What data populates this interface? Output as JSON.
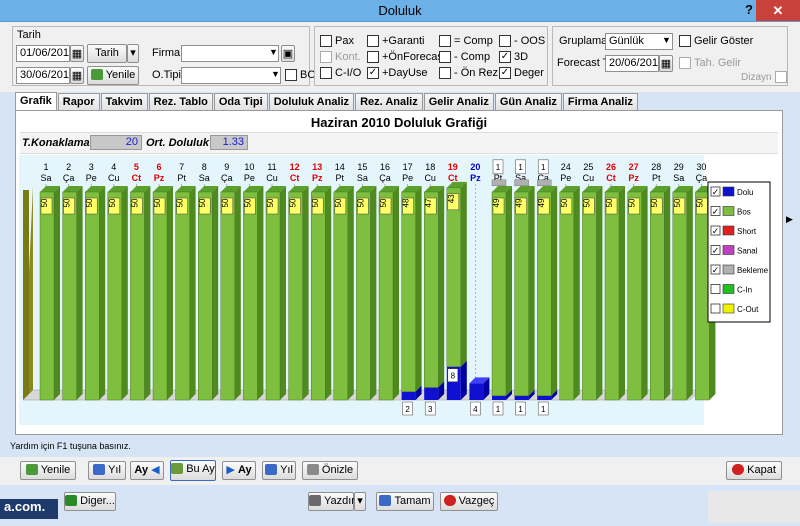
{
  "window": {
    "title": "Doluluk",
    "help": "?",
    "close": "✕"
  },
  "filters": {
    "tarih_label": "Tarih",
    "date_from": "01/06/2010",
    "date_to": "30/06/2010",
    "tarih_button": "Tarih",
    "yenile_button": "Yenile",
    "firma_label": "Firma",
    "firma_value": "",
    "otipi_label": "O.Tipi",
    "otipi_value": "",
    "bo_label": "BO"
  },
  "options": [
    {
      "label": "Pax",
      "checked": false,
      "disabled": false
    },
    {
      "label": "Kont.",
      "checked": false,
      "disabled": true
    },
    {
      "label": "C-I/O",
      "checked": false,
      "disabled": false
    },
    {
      "label": "+Garanti",
      "checked": false,
      "disabled": false
    },
    {
      "label": "+ÖnForecast",
      "checked": false,
      "disabled": false
    },
    {
      "label": "+DayUse",
      "checked": true,
      "disabled": false
    },
    {
      "label": "= Comp",
      "checked": false,
      "disabled": false
    },
    {
      "label": "- Comp",
      "checked": false,
      "disabled": false
    },
    {
      "label": "- Ön Rez.",
      "checked": false,
      "disabled": false
    },
    {
      "label": "- OOS",
      "checked": false,
      "disabled": false
    },
    {
      "label": "3D",
      "checked": true,
      "disabled": false
    },
    {
      "label": "Deger",
      "checked": true,
      "disabled": false
    }
  ],
  "grouping": {
    "gruplama_label": "Gruplama",
    "gruplama_value": "Günlük",
    "forecast_label": "Forecast T.",
    "forecast_value": "20/06/2010",
    "gelir_goster": "Gelir Göster",
    "tah_gelir": "Tah. Gelir",
    "dizayn": "Dizayn"
  },
  "tabs": [
    "Grafik",
    "Rapor",
    "Takvim",
    "Rez. Tablo",
    "Oda Tipi",
    "Doluluk Analiz",
    "Rez. Analiz",
    "Gelir Analiz",
    "Gün Analiz",
    "Firma Analiz"
  ],
  "summary": {
    "tkonaklama_label": "T.Konaklama :",
    "tkonaklama_value": "20",
    "ort_doluluk_label": "Ort. Doluluk :",
    "ort_doluluk_value": "1.33"
  },
  "colors": {
    "dolu": "#1010d0",
    "bos": "#7fbf3f",
    "short": "#e02020",
    "sanal": "#c040c0",
    "bekleme": "#b0b0b0",
    "cin": "#20c020",
    "cout": "#f0f000",
    "weekend": "#e00000",
    "today": "#0000d0"
  },
  "chart_data": {
    "type": "bar",
    "title": "Haziran 2010 Doluluk Grafiği",
    "categories": [
      "1",
      "2",
      "3",
      "4",
      "5",
      "6",
      "7",
      "8",
      "9",
      "10",
      "11",
      "12",
      "13",
      "14",
      "15",
      "16",
      "17",
      "18",
      "19",
      "20",
      "21",
      "22",
      "23",
      "24",
      "25",
      "26",
      "27",
      "28",
      "29",
      "30"
    ],
    "weekdays": [
      "Sa",
      "Ça",
      "Pe",
      "Cu",
      "Ct",
      "Pz",
      "Pt",
      "Sa",
      "Ça",
      "Pe",
      "Cu",
      "Ct",
      "Pz",
      "Pt",
      "Sa",
      "Ça",
      "Pe",
      "Cu",
      "Ct",
      "Pz",
      "Pt",
      "Sa",
      "Ça",
      "Pe",
      "Cu",
      "Ct",
      "Pz",
      "Pt",
      "Sa",
      "Ça"
    ],
    "weekend_days": [
      5,
      6,
      12,
      13,
      19,
      26,
      27
    ],
    "highlight_day": 20,
    "series": [
      {
        "name": "Dolu",
        "values": [
          0,
          0,
          0,
          0,
          0,
          0,
          0,
          0,
          0,
          0,
          0,
          0,
          0,
          0,
          0,
          0,
          2,
          3,
          8,
          4,
          1,
          1,
          1,
          0,
          0,
          0,
          0,
          0,
          0,
          0
        ]
      },
      {
        "name": "Bos",
        "values": [
          50,
          50,
          50,
          50,
          50,
          50,
          50,
          50,
          50,
          50,
          50,
          50,
          50,
          50,
          50,
          50,
          48,
          47,
          43,
          0,
          49,
          49,
          49,
          50,
          50,
          50,
          50,
          50,
          50,
          50
        ]
      },
      {
        "name": "Short",
        "values": []
      },
      {
        "name": "Sanal",
        "values": []
      },
      {
        "name": "Bekleme",
        "values": [
          0,
          0,
          0,
          0,
          0,
          0,
          0,
          0,
          0,
          0,
          0,
          0,
          0,
          0,
          0,
          0,
          0,
          0,
          0,
          0,
          1,
          1,
          1,
          0,
          0,
          0,
          0,
          0,
          0,
          0
        ]
      },
      {
        "name": "C-In",
        "values": []
      },
      {
        "name": "C-Out",
        "values": []
      }
    ],
    "legend": [
      {
        "label": "Dolu",
        "checked": true
      },
      {
        "label": "Bos",
        "checked": true
      },
      {
        "label": "Short",
        "checked": true
      },
      {
        "label": "Sanal",
        "checked": true
      },
      {
        "label": "Bekleme",
        "checked": true
      },
      {
        "label": "C-In",
        "checked": false
      },
      {
        "label": "C-Out",
        "checked": false
      }
    ],
    "ylim": [
      0,
      50
    ],
    "legend_position": "right",
    "three_d": true
  },
  "status": {
    "help_text": "Yardım için F1 tuşuna basınız."
  },
  "bottom_buttons": {
    "yenile": "Yenile",
    "yil_prev": "Yıl",
    "ay_prev": "Ay",
    "bu_ay": "Bu Ay",
    "ay_next": "Ay",
    "yil_next": "Yıl",
    "onizle": "Önizle",
    "kapat": "Kapat"
  },
  "low_buttons": {
    "diger": "Diger...",
    "yazdir": "Yazdır",
    "tamam": "Tamam",
    "vazgec": "Vazgeç",
    "logo_fragment": "a.com."
  }
}
